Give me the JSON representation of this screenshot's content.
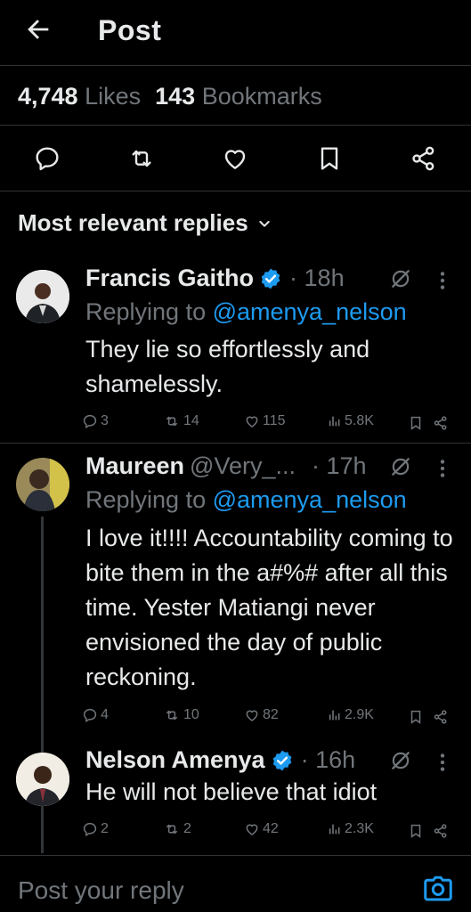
{
  "header": {
    "title": "Post"
  },
  "stats": {
    "likes_count": "4,748",
    "likes_label": "Likes",
    "bookmarks_count": "143",
    "bookmarks_label": "Bookmarks"
  },
  "sort": {
    "label": "Most relevant replies"
  },
  "replies": [
    {
      "name": "Francis Gaitho",
      "handle": "",
      "time": "· 18h",
      "replying_prefix": "Replying to",
      "replying_to": "@amenya_nelson",
      "text": "They lie so effortlessly and shamelessly.",
      "reply_count": "3",
      "repost_count": "14",
      "like_count": "115",
      "view_count": "5.8K"
    },
    {
      "name": "Maureen",
      "handle": "@Very_...",
      "time": "· 17h",
      "replying_prefix": "Replying to",
      "replying_to": "@amenya_nelson",
      "text": "I love it!!!! Accountability coming to bite them in the a#%# after all this time. Yester Matiangi never envisioned the day of public reckoning.",
      "reply_count": "4",
      "repost_count": "10",
      "like_count": "82",
      "view_count": "2.9K"
    },
    {
      "name": "Nelson Amenya",
      "handle": "",
      "time": "· 16h",
      "text": "He will not believe that idiot",
      "reply_count": "2",
      "repost_count": "2",
      "like_count": "42",
      "view_count": "2.3K"
    }
  ],
  "composer": {
    "placeholder": "Post your reply"
  },
  "colors": {
    "background": "#000000",
    "text": "#e7e9ea",
    "muted": "#71767b",
    "accent": "#1d9bf0",
    "divider": "#2f3336"
  }
}
